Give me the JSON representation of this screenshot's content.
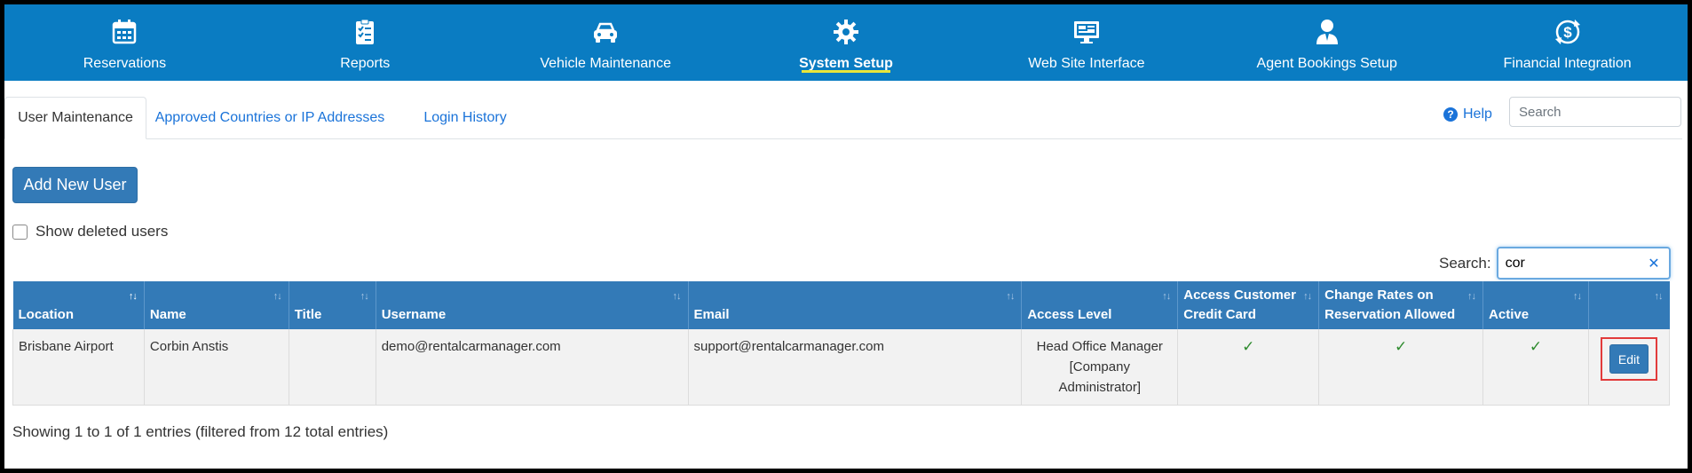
{
  "nav": {
    "items": [
      {
        "label": "Reservations",
        "icon": "calendar-icon"
      },
      {
        "label": "Reports",
        "icon": "clipboard-icon"
      },
      {
        "label": "Vehicle Maintenance",
        "icon": "car-icon"
      },
      {
        "label": "System Setup",
        "icon": "gear-icon"
      },
      {
        "label": "Web Site Interface",
        "icon": "monitor-icon"
      },
      {
        "label": "Agent Bookings Setup",
        "icon": "agent-icon"
      },
      {
        "label": "Financial Integration",
        "icon": "dollar-refresh-icon"
      }
    ],
    "active": "System Setup",
    "bg_color": "#0a7cc2",
    "underline_color": "#e8e53a"
  },
  "tabs": [
    {
      "label": "User Maintenance",
      "active": true
    },
    {
      "label": "Approved Countries or IP Addresses",
      "active": false
    },
    {
      "label": "Login History",
      "active": false
    }
  ],
  "help": {
    "label": "Help"
  },
  "top_search": {
    "placeholder": "Search"
  },
  "add_user_button": "Add New User",
  "show_deleted": {
    "label": "Show deleted users",
    "checked": false
  },
  "table_search": {
    "label": "Search:",
    "value": "cor"
  },
  "table": {
    "columns": [
      "Location",
      "Name",
      "Title",
      "Username",
      "Email",
      "Access Level",
      "Access Customer Credit Card",
      "Change Rates on Reservation Allowed",
      "Active",
      ""
    ],
    "rows": [
      {
        "location": "Brisbane Airport",
        "name": "Corbin Anstis",
        "title": "",
        "username": "demo@rentalcarmanager.com",
        "email": "support@rentalcarmanager.com",
        "access_level": "Head Office Manager [Company Administrator]",
        "access_credit_card": true,
        "change_rates": true,
        "active": true,
        "edit_label": "Edit"
      }
    ]
  },
  "footer": "Showing 1 to 1 of 1 entries (filtered from 12 total entries)"
}
